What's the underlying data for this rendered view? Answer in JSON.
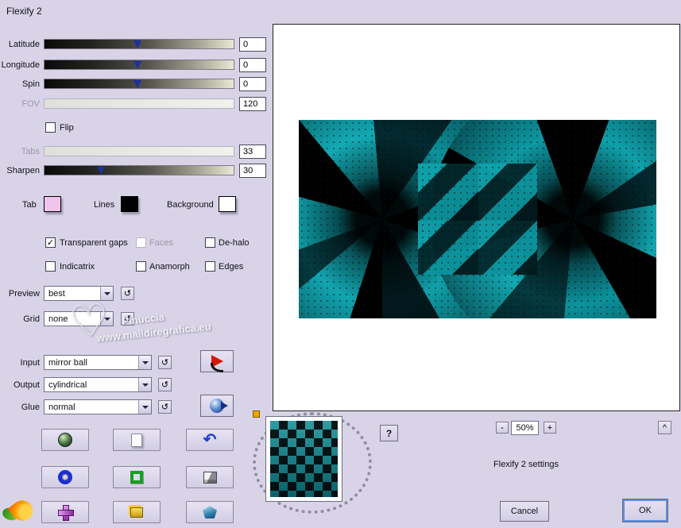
{
  "title": "Flexify 2",
  "sliders": {
    "latitude": {
      "label": "Latitude",
      "value": "0"
    },
    "longitude": {
      "label": "Longitude",
      "value": "0"
    },
    "spin": {
      "label": "Spin",
      "value": "0"
    },
    "fov": {
      "label": "FOV",
      "value": "120"
    },
    "tabs": {
      "label": "Tabs",
      "value": "33"
    },
    "sharpen": {
      "label": "Sharpen",
      "value": "30"
    }
  },
  "checkboxes": {
    "flip": {
      "label": "Flip",
      "glyph": ""
    },
    "transparent_gaps": {
      "label": "Transparent gaps",
      "glyph": "✓"
    },
    "faces": {
      "label": "Faces",
      "glyph": ""
    },
    "dehalo": {
      "label": "De-halo",
      "glyph": ""
    },
    "indicatrix": {
      "label": "Indicatrix",
      "glyph": ""
    },
    "anamorph": {
      "label": "Anamorph",
      "glyph": ""
    },
    "edges": {
      "label": "Edges",
      "glyph": ""
    }
  },
  "swatches": {
    "tab": {
      "label": "Tab",
      "color": "#f0c4ec"
    },
    "lines": {
      "label": "Lines",
      "color": "#000000"
    },
    "background": {
      "label": "Background",
      "color": "#ffffff"
    }
  },
  "dropdowns": {
    "preview": {
      "label": "Preview",
      "value": "best"
    },
    "grid": {
      "label": "Grid",
      "value": "none"
    },
    "input": {
      "label": "Input",
      "value": "mirror ball"
    },
    "output": {
      "label": "Output",
      "value": "cylindrical"
    },
    "glue": {
      "label": "Glue",
      "value": "normal"
    }
  },
  "icons": {
    "reset": "↺",
    "undo": "↶",
    "help": "?",
    "zoom_out": "-",
    "zoom_in": "+",
    "collapse": "^"
  },
  "watermark": {
    "heart": "♡",
    "line1": "Pinuccia",
    "line2": "www.maildiregrafica.eu"
  },
  "footer": {
    "zoom_value": "50%",
    "settings_text": "Flexify 2 settings",
    "cancel_label": "Cancel",
    "ok_label": "OK"
  },
  "colors": {
    "dialog_bg": "#d9d3e7",
    "teal": "#0fa0aa",
    "marker_blue": "#1e2f9e"
  }
}
